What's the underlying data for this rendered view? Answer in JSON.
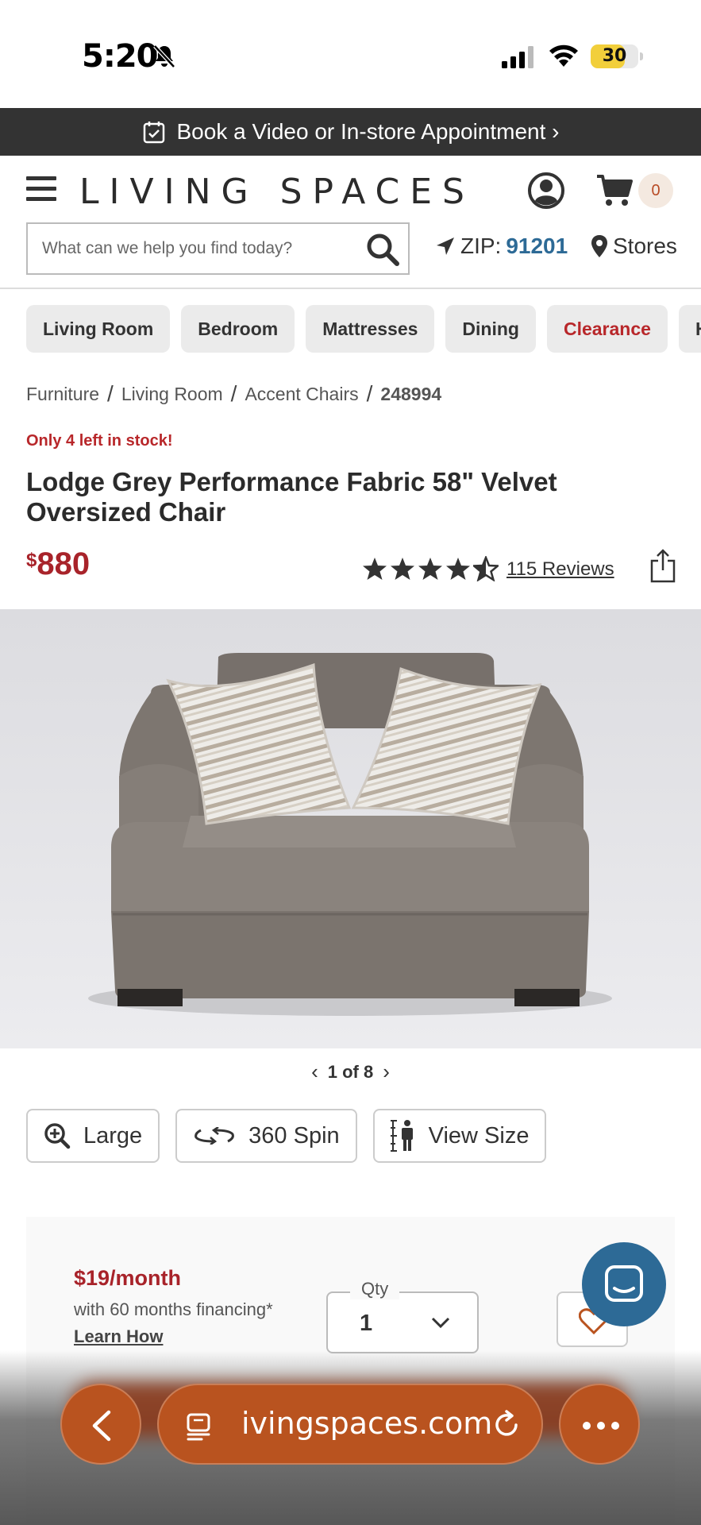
{
  "status_bar": {
    "time": "5:20",
    "battery": "30",
    "battery_level_pct": 30
  },
  "promo": {
    "text": "Book a Video or In-store Appointment ›"
  },
  "header": {
    "logo": "LIVING SPACES",
    "cart_count": "0",
    "search_placeholder": "What can we help you find today?",
    "zip_label": "ZIP:",
    "zip_value": "91201",
    "stores_label": "Stores"
  },
  "categories": [
    "Living Room",
    "Bedroom",
    "Mattresses",
    "Dining",
    "Clearance",
    "Hom"
  ],
  "breadcrumb": {
    "items": [
      "Furniture",
      "Living Room",
      "Accent Chairs"
    ],
    "current": "248994",
    "separator": "/"
  },
  "product": {
    "stock_notice": "Only 4 left in stock!",
    "title": "Lodge Grey Performance Fabric 58\" Velvet Oversized Chair",
    "currency": "$",
    "price": "880",
    "rating": 4.5,
    "reviews_label": "115 Reviews",
    "image_counter": "1 of 8"
  },
  "media_buttons": {
    "large": "Large",
    "spin": "360 Spin",
    "view_size": "View Size"
  },
  "purchase": {
    "financing_amount": "$19/month",
    "financing_sub": "with 60 months financing*",
    "learn_how": "Learn How",
    "qty_label": "Qty",
    "qty_value": "1"
  },
  "browser": {
    "url": "ivingspaces.com"
  },
  "colors": {
    "accent_red": "#a8232a",
    "link_blue": "#2d6a96",
    "browser_orange": "#b9531f",
    "banner_dark": "#333333"
  },
  "icons": [
    "bell-slash-icon",
    "signal-icon",
    "wifi-icon",
    "calendar-check-icon",
    "hamburger-icon",
    "account-icon",
    "cart-icon",
    "search-icon",
    "location-arrow-icon",
    "map-pin-icon",
    "star-icon",
    "share-icon",
    "zoom-icon",
    "spin-icon",
    "person-size-icon",
    "chevron-down-icon",
    "heart-icon",
    "chat-icon",
    "back-icon",
    "tabs-icon",
    "reload-icon",
    "more-icon"
  ]
}
